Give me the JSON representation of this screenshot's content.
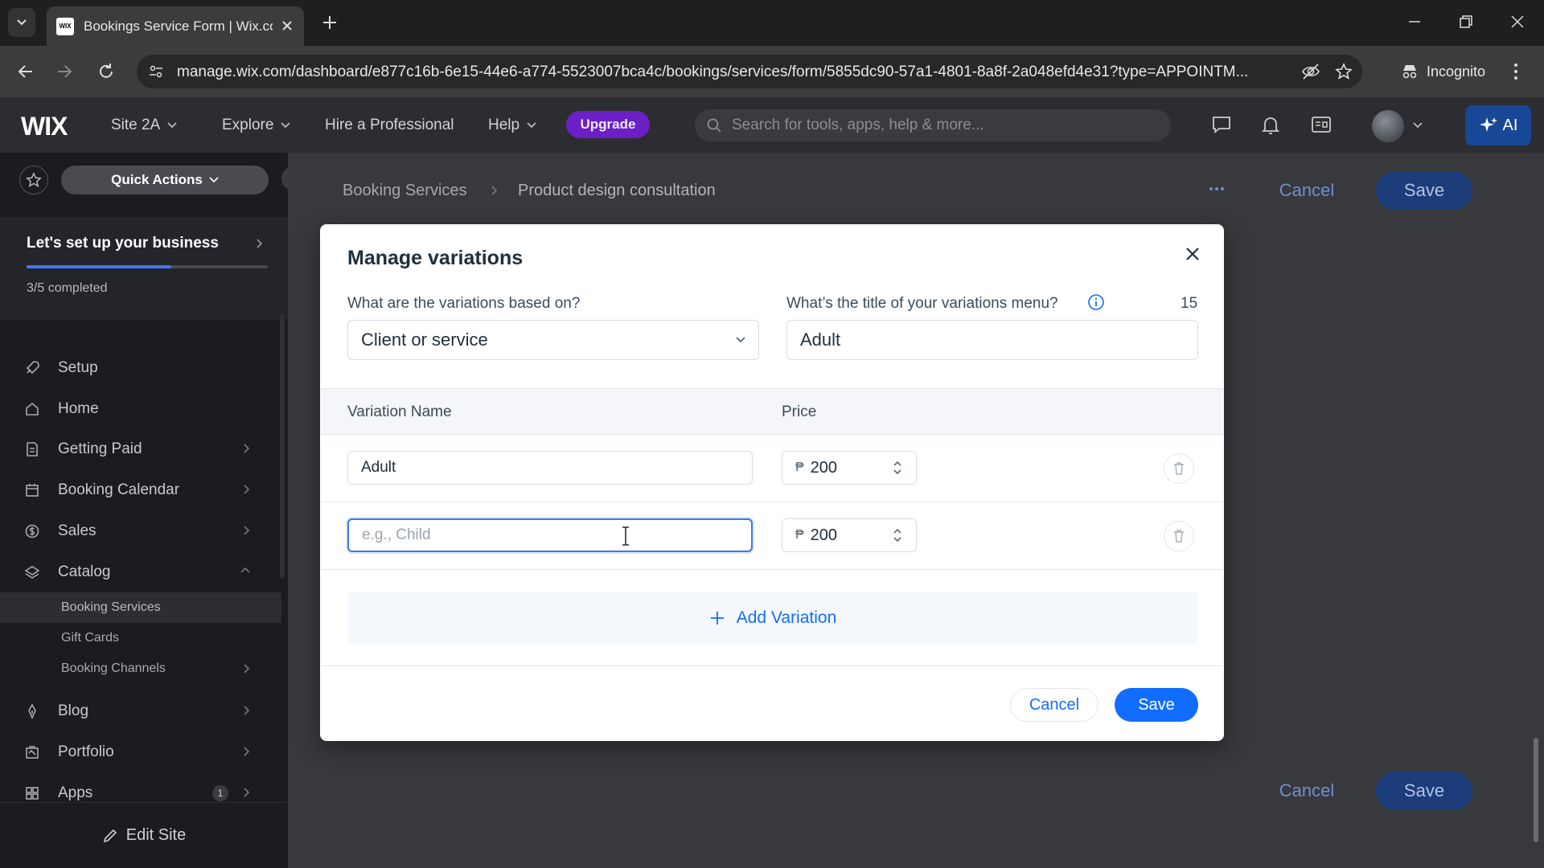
{
  "browser": {
    "tab_title": "Bookings Service Form | Wix.com",
    "tab_favicon_text": "WIX",
    "url": "manage.wix.com/dashboard/e877c16b-6e15-44e6-a774-5523007bca4c/bookings/services/form/5855dc90-57a1-4801-8a8f-2a048efd4e31?type=APPOINTM...",
    "incognito_label": "Incognito"
  },
  "wix_header": {
    "logo": "WIX",
    "site_name": "Site 2A",
    "explore": "Explore",
    "hire": "Hire a Professional",
    "help": "Help",
    "upgrade": "Upgrade",
    "search_placeholder": "Search for tools, apps, help & more...",
    "ai_label": "AI"
  },
  "sidebar": {
    "quick_actions": "Quick Actions",
    "setup_title": "Let's set up your business",
    "setup_progress": 0.6,
    "setup_count": "3/5 completed",
    "items": [
      {
        "label": "Setup",
        "icon": "rocket-icon"
      },
      {
        "label": "Home",
        "icon": "home-icon"
      },
      {
        "label": "Getting Paid",
        "icon": "payment-icon"
      },
      {
        "label": "Booking Calendar",
        "icon": "calendar-icon"
      },
      {
        "label": "Sales",
        "icon": "dollar-icon"
      },
      {
        "label": "Catalog",
        "icon": "catalog-icon"
      },
      {
        "label": "Blog",
        "icon": "pen-icon"
      },
      {
        "label": "Portfolio",
        "icon": "portfolio-icon"
      },
      {
        "label": "Apps",
        "icon": "apps-icon",
        "badge": "1"
      }
    ],
    "catalog_sub": [
      "Booking Services",
      "Gift Cards",
      "Booking Channels"
    ],
    "edit_site": "Edit Site"
  },
  "page": {
    "breadcrumb": [
      "Booking Services",
      "Product design consultation"
    ],
    "cancel": "Cancel",
    "save": "Save"
  },
  "modal": {
    "title": "Manage variations",
    "based_on_label": "What are the variations based on?",
    "based_on_value": "Client or service",
    "menu_title_label": "What’s the title of your variations menu?",
    "menu_title_value": "Adult",
    "char_count": "15",
    "col_name": "Variation Name",
    "col_price": "Price",
    "rows": [
      {
        "name": "Adult",
        "placeholder": "",
        "currency": "₱",
        "price": "200"
      },
      {
        "name": "",
        "placeholder": "e.g., Child",
        "currency": "₱",
        "price": "200"
      }
    ],
    "add_variation": "Add Variation",
    "cancel": "Cancel",
    "save": "Save"
  },
  "colors": {
    "accent": "#116dff",
    "upgrade": "#6b1fc4",
    "sidebar_bg": "#1b1c1f"
  }
}
